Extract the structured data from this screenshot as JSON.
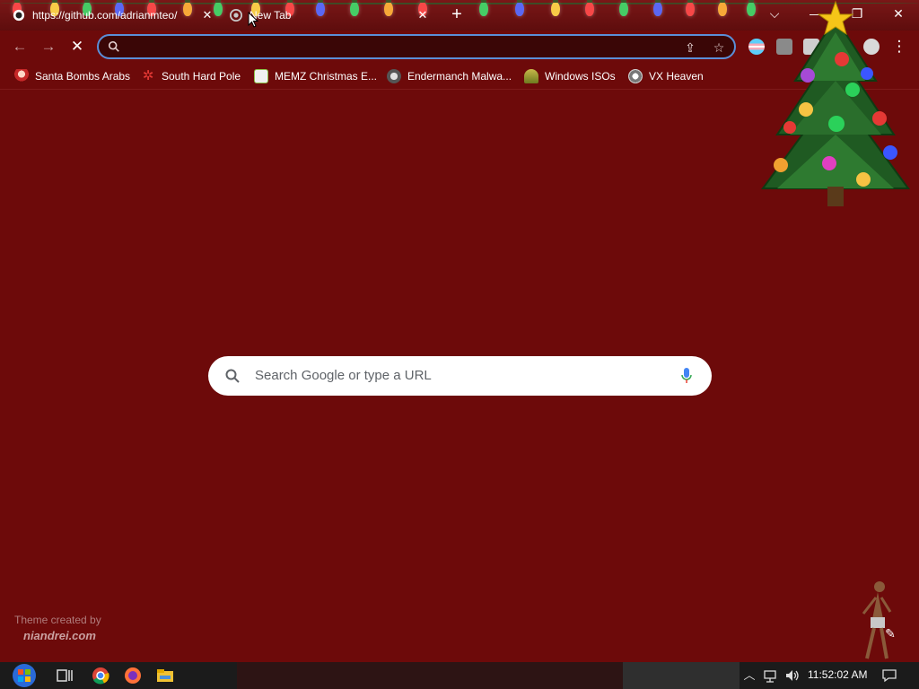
{
  "tabs": [
    {
      "title": "https://github.com/adrianmteo/",
      "active": false,
      "close": "✕"
    },
    {
      "title": "New Tab",
      "active": true,
      "close": "✕"
    }
  ],
  "new_tab_glyph": "+",
  "window_controls": {
    "tab_search": "⌵",
    "minimize": "—",
    "restore": "❐",
    "close": "✕"
  },
  "toolbar": {
    "back": "←",
    "forward": "→",
    "stop": "✕",
    "address_value": "",
    "share": "⇪",
    "bookmark_star": "☆",
    "menu": "⋮"
  },
  "bookmarks": [
    {
      "label": "Santa Bombs Arabs",
      "icon": "santa-icon",
      "color": "#d9d9d9"
    },
    {
      "label": "South Hard Pole",
      "icon": "snowflake-icon",
      "color": "#e53935"
    },
    {
      "label": "MEMZ Christmas E...",
      "icon": "memz-icon",
      "color": "#f0f0f0"
    },
    {
      "label": "Endermanch Malwa...",
      "icon": "endermanch-icon",
      "color": "#9e9e9e"
    },
    {
      "label": "Windows ISOs",
      "icon": "windows-iso-icon",
      "color": "#8d8f2f"
    },
    {
      "label": "VX Heaven",
      "icon": "vx-heaven-icon",
      "color": "#cfcfcf"
    }
  ],
  "search": {
    "placeholder": "Search Google or type a URL"
  },
  "theme_credit": {
    "line1": "Theme created by",
    "line2": "niandrei.com"
  },
  "taskbar": {
    "clock": "11:52:02 AM"
  },
  "colors": {
    "background": "#6d0a0a",
    "omnibox_border": "#5b8fd8",
    "search_bg": "#ffffff"
  }
}
